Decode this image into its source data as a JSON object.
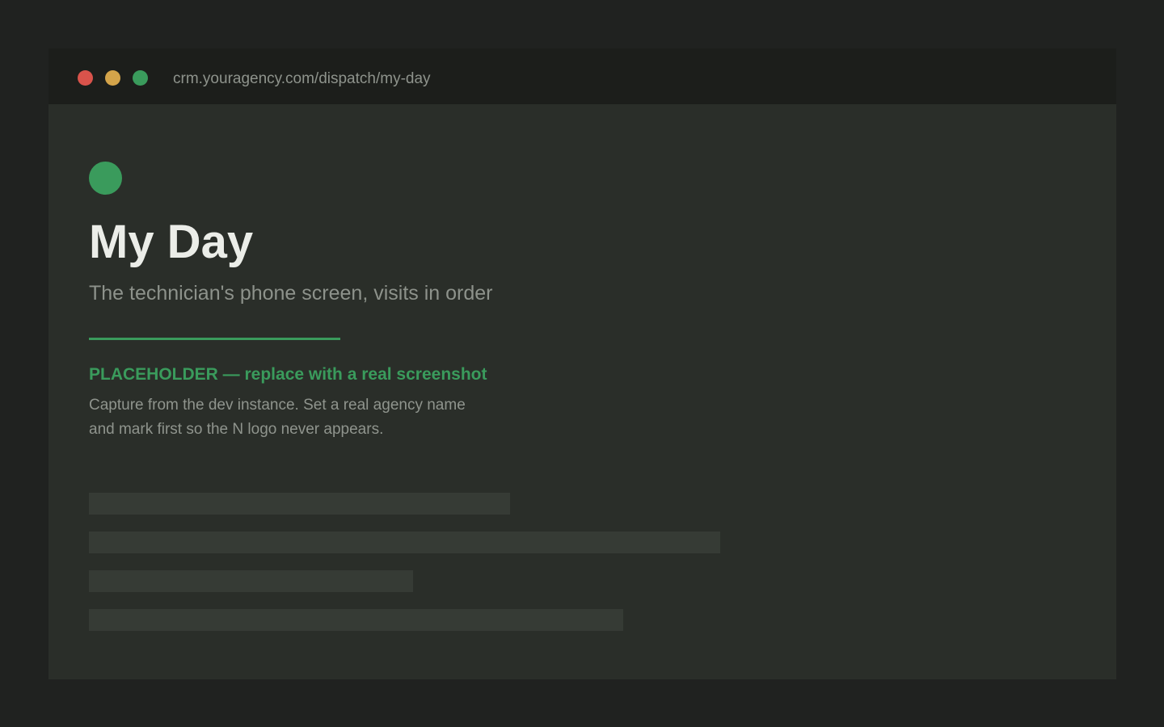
{
  "colors": {
    "close": "#d9534b",
    "minimize": "#d4a44a",
    "maximize": "#3a9b5c",
    "accent": "#3a9b5c"
  },
  "browser": {
    "url": "crm.youragency.com/dispatch/my-day"
  },
  "page": {
    "title": "My Day",
    "subtitle": "The technician's phone screen, visits in order"
  },
  "placeholder": {
    "heading": "PLACEHOLDER — replace with a real screenshot",
    "note_lines": [
      "Capture from the dev instance. Set a real agency name",
      "and mark first so the N logo never appears."
    ]
  }
}
